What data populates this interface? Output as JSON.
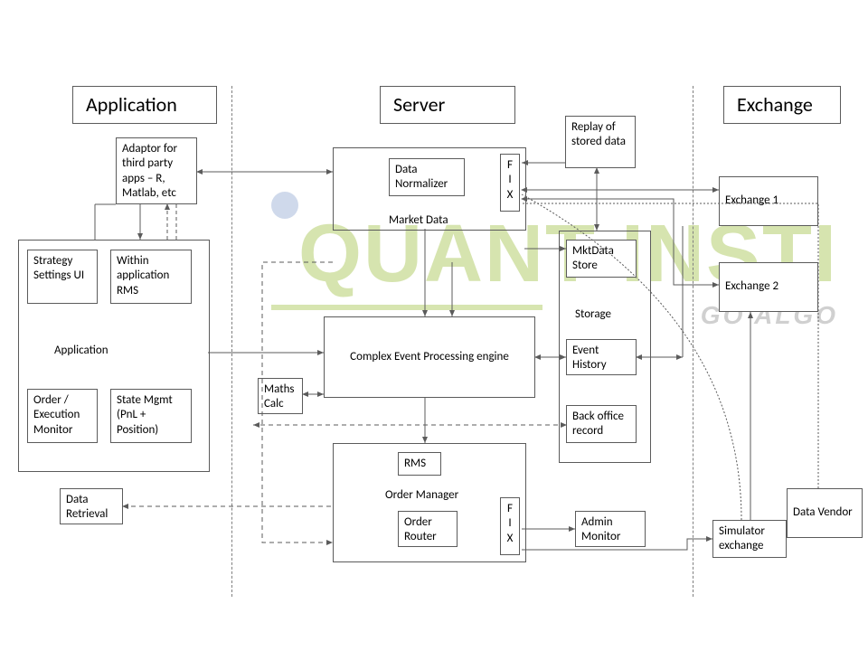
{
  "sections": {
    "application": "Application",
    "server": "Server",
    "exchange": "Exchange"
  },
  "watermark": {
    "brand": "QUANT INSTI",
    "tag": "GO ALGO"
  },
  "app": {
    "adaptor": "Adaptor for third party apps – R, Matlab, etc",
    "label": "Application",
    "strategy": "Strategy Settings UI",
    "within_rms": "Within application RMS",
    "order_monitor": "Order / Execution Monitor",
    "state_mgmt": "State Mgmt (PnL + Position)",
    "data_retrieval": "Data Retrieval"
  },
  "server": {
    "market_data_label": "Market Data",
    "data_normalizer": "Data Normalizer",
    "fix1": "F\nI\nX",
    "cep": "Complex Event Processing engine",
    "maths": "Maths Calc",
    "order_manager_label": "Order Manager",
    "rms": "RMS",
    "order_router": "Order Router",
    "fix2": "F\nI\nX",
    "replay": "Replay of stored data",
    "storage_label": "Storage",
    "mktdata_store": "MktData Store",
    "event_history": "Event History",
    "backoffice": "Back office record",
    "admin_monitor": "Admin Monitor"
  },
  "exchange": {
    "ex1": "Exchange 1",
    "ex2": "Exchange 2",
    "simulator": "Simulator exchange",
    "data_vendor": "Data Vendor"
  }
}
